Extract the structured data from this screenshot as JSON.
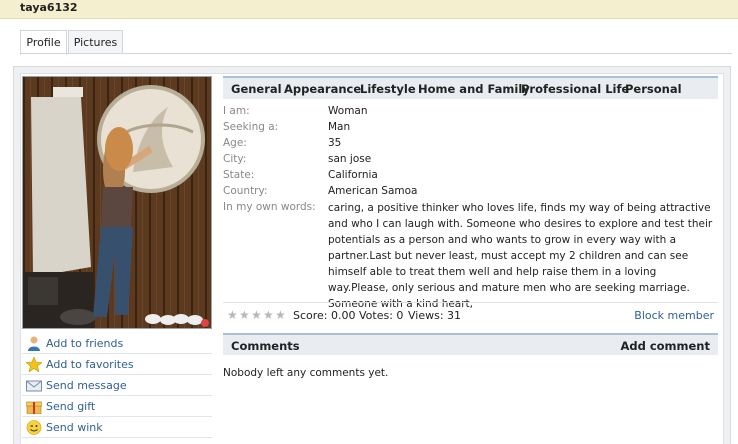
{
  "header": {
    "username": "taya6132"
  },
  "tabs": [
    {
      "label": "Profile",
      "active": true
    },
    {
      "label": "Pictures",
      "active": false
    }
  ],
  "actions": [
    {
      "label": "Add to friends",
      "icon": "person-icon"
    },
    {
      "label": "Add to favorites",
      "icon": "star-icon"
    },
    {
      "label": "Send message",
      "icon": "envelope-icon"
    },
    {
      "label": "Send gift",
      "icon": "gift-icon"
    },
    {
      "label": "Send wink",
      "icon": "smiley-icon"
    }
  ],
  "categories": [
    "General",
    "Appearance",
    "Lifestyle",
    "Home and Family",
    "Professional Life",
    "Personal"
  ],
  "profile": [
    {
      "label": "I am:",
      "value": "Woman"
    },
    {
      "label": "Seeking a:",
      "value": "Man"
    },
    {
      "label": "Age:",
      "value": "35"
    },
    {
      "label": "City:",
      "value": "san jose"
    },
    {
      "label": "State:",
      "value": "California"
    },
    {
      "label": "Country:",
      "value": "American Samoa"
    },
    {
      "label": "In my own words:",
      "value": "caring, a positive thinker who loves life, finds my way of being attractive and who I can laugh with. Someone who desires to explore and test their potentials as a person and who wants to grow in every way with a partner.Last but never least, must accept my 2 children and can see himself able to treat them well and help raise them in a loving way.Please, only serious and mature men who are seeking marriage. Someone with a kind heart,"
    }
  ],
  "rating": {
    "stars_total": 5,
    "stars_filled": 0,
    "score_text": "Score: 0.00 Votes: 0",
    "views_text": "Views: 31",
    "block_label": "Block member"
  },
  "comments": {
    "title": "Comments",
    "add_label": "Add comment",
    "empty_text": "Nobody left any comments yet."
  },
  "colors": {
    "link": "#2f5f94",
    "header_bg": "#f4efce",
    "section_bar": "#e9edf1",
    "section_border": "#a8bfd4"
  }
}
